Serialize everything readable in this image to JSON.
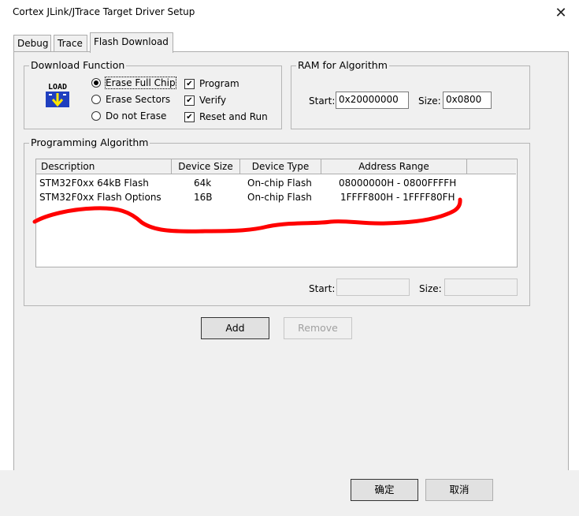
{
  "window": {
    "title": "Cortex JLink/JTrace Target Driver Setup",
    "close_glyph": "✕"
  },
  "tabs": [
    {
      "label": "Debug"
    },
    {
      "label": "Trace"
    },
    {
      "label": "Flash Download",
      "active": true
    }
  ],
  "download_function": {
    "title": "Download Function",
    "icon_text": "LOAD",
    "options": [
      {
        "label": "Erase Full Chip",
        "selected": true
      },
      {
        "label": "Erase Sectors",
        "selected": false
      },
      {
        "label": "Do not Erase",
        "selected": false
      }
    ],
    "checks": [
      {
        "label": "Program",
        "checked": true
      },
      {
        "label": "Verify",
        "checked": true
      },
      {
        "label": "Reset and Run",
        "checked": true
      }
    ]
  },
  "ram_for_algorithm": {
    "title": "RAM for Algorithm",
    "start_label": "Start:",
    "start_value": "0x20000000",
    "size_label": "Size:",
    "size_value": "0x0800"
  },
  "programming_algorithm": {
    "title": "Programming Algorithm",
    "columns": [
      "Description",
      "Device Size",
      "Device Type",
      "Address Range"
    ],
    "rows": [
      {
        "description": "STM32F0xx 64kB Flash",
        "device_size": "64k",
        "device_type": "On-chip Flash",
        "address_range": "08000000H - 0800FFFFH"
      },
      {
        "description": "STM32F0xx Flash Options",
        "device_size": "16B",
        "device_type": "On-chip Flash",
        "address_range": "1FFFF800H - 1FFFF80FH"
      }
    ],
    "start_label": "Start:",
    "start_value": "",
    "size_label": "Size:",
    "size_value": ""
  },
  "buttons": {
    "add": "Add",
    "remove": "Remove",
    "ok": "确定",
    "cancel": "取消"
  },
  "colors": {
    "annotation_stroke": "#ff0000",
    "panel_bg": "#f0f0f0"
  }
}
